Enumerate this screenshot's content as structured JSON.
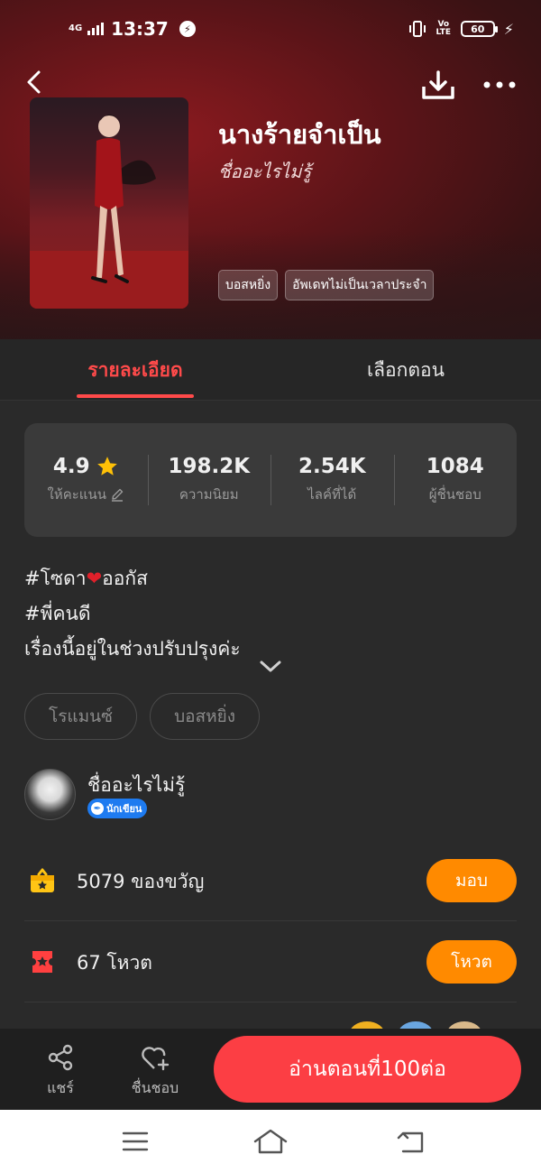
{
  "status_bar": {
    "network": "4G",
    "time": "13:37",
    "volte": "Vo LTE",
    "battery": "60"
  },
  "book": {
    "title": "นางร้ายจำเป็น",
    "author": "ชื่ออะไรไม่รู้",
    "tags": [
      "บอสหยิ่ง",
      "อัพเดทไม่เป็นเวลาประจำ"
    ]
  },
  "tabs": [
    "รายละเอียด",
    "เลือกตอน"
  ],
  "stats": [
    {
      "value": "4.9",
      "label": "ให้คะแนน"
    },
    {
      "value": "198.2K",
      "label": "ความนิยม"
    },
    {
      "value": "2.54K",
      "label": "ไลค์ที่ได้"
    },
    {
      "value": "1084",
      "label": "ผู้ชื่นชอบ"
    }
  ],
  "description": {
    "line1_before": "#โซดา",
    "line1_after": "ออกัส",
    "line2": "#พี่คนดี",
    "line3": "เรื่องนี้อยู่ในช่วงปรับปรุงค่ะ"
  },
  "genres": [
    "โรแมนซ์",
    "บอสหยิ่ง"
  ],
  "author_section": {
    "name": "ชื่ออะไรไม่รู้",
    "badge": "นักเขียน"
  },
  "gift": {
    "label": "5079 ของขวัญ",
    "button": "มอบ"
  },
  "vote": {
    "label": "67 โหวต",
    "button": "โหวต"
  },
  "bottom_bar": {
    "share": "แชร์",
    "like": "ชื่นชอบ",
    "read": "อ่านตอนที่100ต่อ"
  },
  "colors": {
    "accent": "#ff4a4a",
    "read_button": "#fc3e44",
    "orange_button": "#ff8a00",
    "background": "#2a2a2a"
  }
}
